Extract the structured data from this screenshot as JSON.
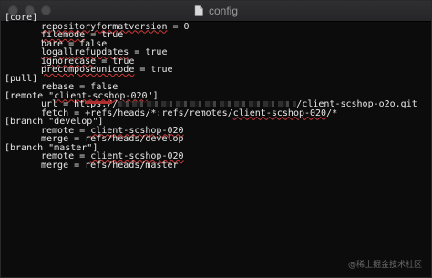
{
  "window": {
    "title": "config",
    "controls": [
      "close",
      "minimize",
      "maximize"
    ]
  },
  "editor": {
    "lines": [
      {
        "text": "[core]",
        "indent": false
      },
      {
        "text": "repositoryformatversion = 0",
        "indent": true,
        "squiggle": "repositoryformatversion"
      },
      {
        "text": "filemode = true",
        "indent": true,
        "squiggle": "filemode"
      },
      {
        "text": "bare = false",
        "indent": true
      },
      {
        "text": "logallrefupdates = true",
        "indent": true,
        "squiggle": "logallrefupdates"
      },
      {
        "text": "ignorecase = true",
        "indent": true,
        "squiggle": "ignorecase"
      },
      {
        "text": "precomposeunicode = true",
        "indent": true,
        "squiggle": "precomposeunicode"
      },
      {
        "text": "[pull]",
        "indent": false
      },
      {
        "text": "rebase = false",
        "indent": true
      },
      {
        "text": "[remote \"client-scshop-020\"]",
        "indent": false,
        "squiggle": "client-scshop-020"
      },
      {
        "text_before": "url = https://",
        "text_after": "/client-scshop-o2o.git",
        "indent": true,
        "redacted": true
      },
      {
        "text": "fetch = +refs/heads/*:refs/remotes/client-scshop-020/*",
        "indent": true,
        "squiggle": "client-scshop-020"
      },
      {
        "text": "[branch \"develop\"]",
        "indent": false
      },
      {
        "text": "remote = client-scshop-020",
        "indent": true,
        "squiggle": "client-scshop-020"
      },
      {
        "text": "merge = refs/heads/develop",
        "indent": true
      },
      {
        "text": "[branch \"master\"]",
        "indent": false
      },
      {
        "text": "remote = client-scshop-020",
        "indent": true,
        "squiggle": "client-scshop-020"
      },
      {
        "text": "merge = refs/heads/master",
        "indent": true
      }
    ]
  },
  "watermark": "@稀土掘金技术社区",
  "icons": {
    "title_icon": "document-icon"
  }
}
